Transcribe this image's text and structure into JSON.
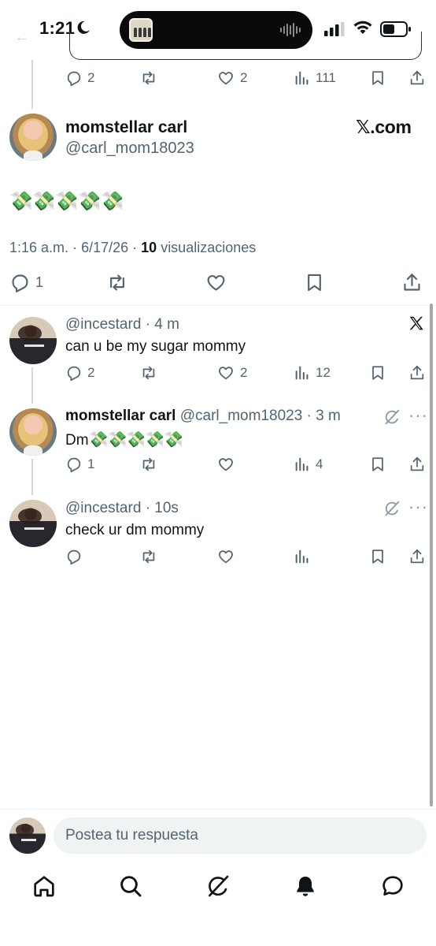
{
  "status_bar": {
    "time": "1:21",
    "icons": [
      "moon-icon",
      "signal-icon",
      "wifi-icon",
      "battery-icon"
    ]
  },
  "top_tweet": {
    "stats": {
      "replies": "2",
      "likes": "2",
      "views": "111"
    }
  },
  "main_tweet": {
    "name": "momstellar carl",
    "handle": "@carl_mom18023",
    "source_label": "𝕏.com",
    "content": "💸💸💸💸💸",
    "time": "1:16 a.m.",
    "date": "6/17/26",
    "views_count": "10",
    "views_label": "visualizaciones",
    "stats": {
      "replies": "1"
    }
  },
  "replies": [
    {
      "handle": "@incestard",
      "time": "4 m",
      "content": "can u be my sugar mommy",
      "stats": {
        "replies": "2",
        "retweets": "",
        "likes": "2",
        "views": "12"
      }
    },
    {
      "name": "momstellar carl",
      "handle": "@carl_mom18023",
      "time": "3 m",
      "content_prefix": "Dm",
      "content_emoji": "💸💸💸💸💸",
      "stats": {
        "replies": "1",
        "retweets": "",
        "likes": "",
        "views": "4"
      }
    },
    {
      "handle": "@incestard",
      "time": "10s",
      "content": "check ur dm mommy",
      "stats": {
        "replies": "",
        "retweets": "",
        "likes": "",
        "views": ""
      }
    }
  ],
  "compose": {
    "placeholder": "Postea tu respuesta"
  },
  "bottom_nav": [
    "home-icon",
    "search-icon",
    "grok-icon",
    "notifications-icon",
    "messages-icon"
  ],
  "colors": {
    "text_primary": "#0f1419",
    "text_secondary": "#536471",
    "divider": "#eff3f4",
    "thread_line": "#cfd9de"
  }
}
